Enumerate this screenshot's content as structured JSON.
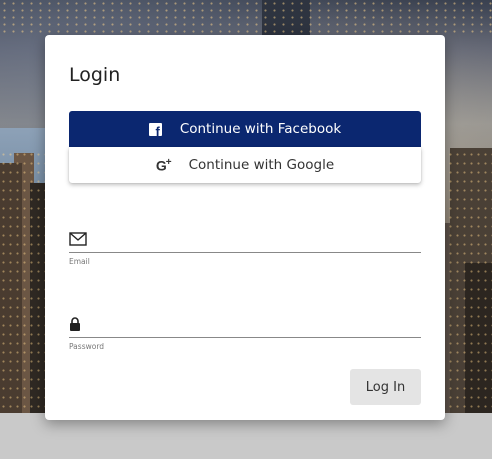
{
  "login": {
    "title": "Login",
    "facebook_label": "Continue with Facebook",
    "google_label": "Continue with Google",
    "email": {
      "label": "Email",
      "value": "",
      "placeholder": ""
    },
    "password": {
      "label": "Password",
      "value": "",
      "placeholder": ""
    },
    "submit_label": "Log In"
  },
  "icons": {
    "facebook": "facebook-icon",
    "google": "google-plus-icon",
    "email": "envelope-icon",
    "password": "lock-icon"
  },
  "colors": {
    "facebook_button": "#0b2770",
    "login_button": "#e4e4e4",
    "card": "#ffffff"
  }
}
